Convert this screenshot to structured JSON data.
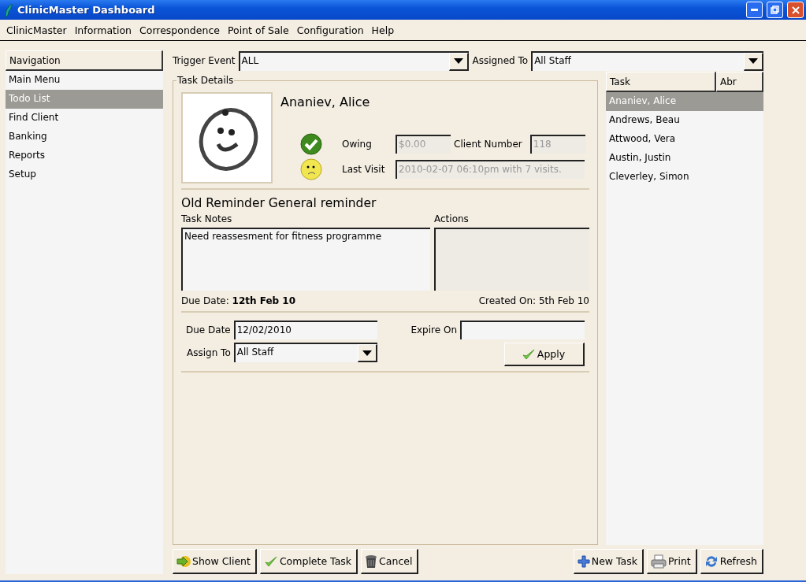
{
  "window": {
    "title": "ClinicMaster Dashboard"
  },
  "menu": [
    "ClinicMaster",
    "Information",
    "Correspondence",
    "Point of Sale",
    "Configuration",
    "Help"
  ],
  "navigation": {
    "header": "Navigation",
    "items": [
      {
        "label": "Main Menu",
        "selected": false
      },
      {
        "label": "Todo List",
        "selected": true
      },
      {
        "label": "Find Client",
        "selected": false
      },
      {
        "label": "Banking",
        "selected": false
      },
      {
        "label": "Reports",
        "selected": false
      },
      {
        "label": "Setup",
        "selected": false
      }
    ]
  },
  "filters": {
    "trigger_event": {
      "label": "Trigger Event",
      "value": "ALL"
    },
    "assigned_to": {
      "label": "Assigned To",
      "value": "All Staff"
    }
  },
  "task_details": {
    "legend": "Task Details",
    "client_name": "Ananiev, Alice",
    "owing": {
      "label": "Owing",
      "value": "$0.00",
      "disabled": true
    },
    "client_number": {
      "label": "Client Number",
      "value": "118",
      "disabled": true
    },
    "last_visit": {
      "label": "Last Visit",
      "value": "2010-02-07 06:10pm with 7 visits.",
      "disabled": true
    },
    "task_title": "Old Reminder General reminder",
    "task_notes": {
      "label": "Task Notes",
      "value": "Need reassesment for fitness programme"
    },
    "actions": {
      "label": "Actions",
      "disabled": true
    },
    "due_summary": "Due Date: **12th Feb 10**",
    "created_on": "Created On: 5th Feb 10",
    "due_date": {
      "label": "Due Date",
      "value": "12/02/2010"
    },
    "expire_on": {
      "label": "Expire On"
    },
    "assign_to": {
      "label": "Assign To",
      "value": "All Staff"
    },
    "apply_button": "Apply"
  },
  "task_list": {
    "columns": [
      "Task",
      "Abr"
    ],
    "rows": [
      {
        "task": "Ananiev, Alice",
        "selected": true
      },
      {
        "task": "Andrews, Beau",
        "selected": false
      },
      {
        "task": "Attwood, Vera",
        "selected": false
      },
      {
        "task": "Austin, Justin",
        "selected": false
      },
      {
        "task": "Cleverley, Simon",
        "selected": false
      }
    ]
  },
  "buttons_left": [
    {
      "label": "Show Client",
      "kind": "show"
    },
    {
      "label": "Complete Task",
      "kind": "complete"
    },
    {
      "label": "Cancel",
      "kind": "cancel"
    }
  ],
  "buttons_right": [
    {
      "label": "New Task",
      "kind": "new"
    },
    {
      "label": "Print",
      "kind": "print"
    },
    {
      "label": "Refresh",
      "kind": "refresh"
    }
  ]
}
